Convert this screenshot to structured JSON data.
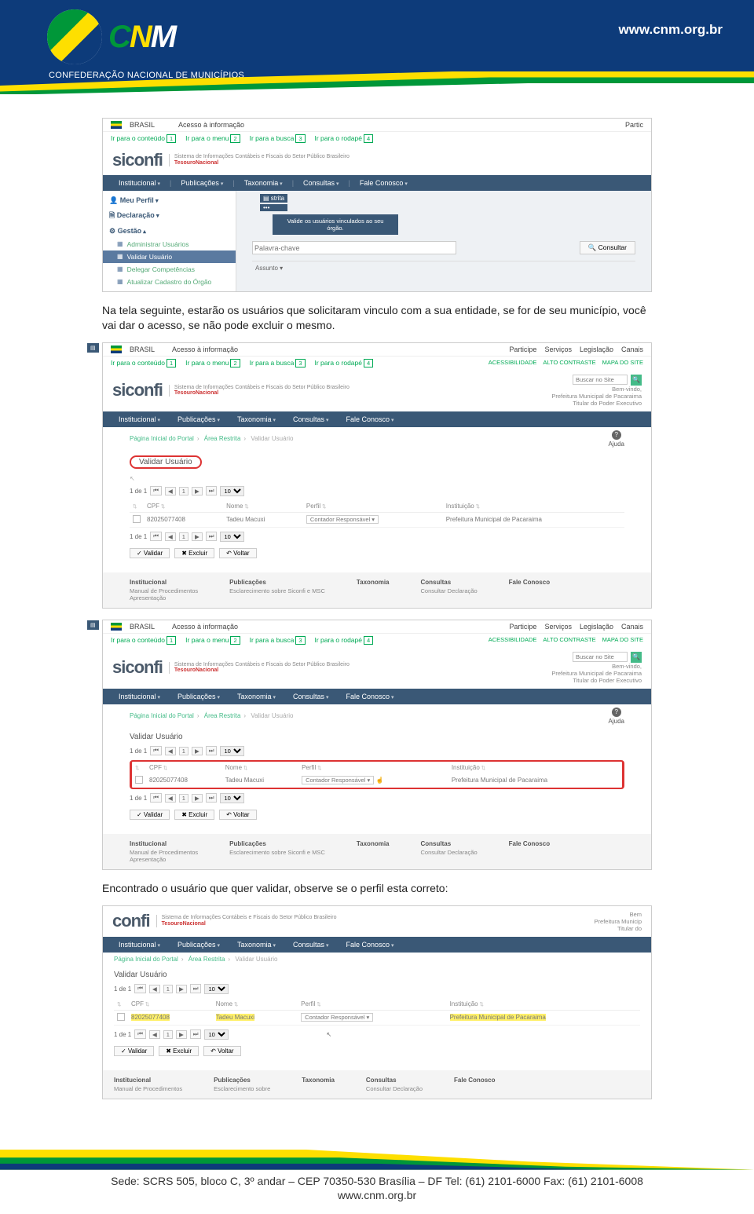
{
  "header": {
    "url": "www.cnm.org.br",
    "logo_letters": [
      "C",
      "N",
      "M"
    ],
    "org_name": "CONFEDERAÇÃO NACIONAL DE MUNICÍPIOS"
  },
  "shot1": {
    "gov_brasil": "BRASIL",
    "gov_acesso": "Acesso à informação",
    "gov_participe": "Partic",
    "skip": [
      {
        "t": "Ir para o conteúdo",
        "n": "1"
      },
      {
        "t": "Ir para o menu",
        "n": "2"
      },
      {
        "t": "Ir para a busca",
        "n": "3"
      },
      {
        "t": "Ir para o rodapé",
        "n": "4"
      }
    ],
    "brand": "siconfi",
    "brand_tag": "Sistema de Informações Contábeis e Fiscais do Setor Público Brasileiro",
    "brand_tn": "TesouroNacional",
    "nav": [
      "Institucional",
      "Publicações",
      "Taxonomia",
      "Consultas",
      "Fale Conosco"
    ],
    "side": {
      "meu_perfil": "Meu Perfil",
      "declaracao": "Declaração",
      "gestao": "Gestão",
      "items": [
        "Administrar Usuários",
        "Validar Usuário",
        "Delegar Competências",
        "Atualizar Cadastro do Órgão"
      ]
    },
    "badge_text": "strita",
    "tooltip": "Valide os usuários vinculados ao seu órgão.",
    "palavra": "Palavra-chave",
    "consultar": "Consultar",
    "assunto": "Assunto"
  },
  "para1": "Na tela seguinte, estarão os usuários que solicitaram vinculo com a sua entidade, se for de seu município, você vai dar o acesso, se não pode excluir o mesmo.",
  "shot_vu": {
    "gov_brasil": "BRASIL",
    "gov_acesso": "Acesso à informação",
    "top_right": [
      "Participe",
      "Serviços",
      "Legislação",
      "Canais"
    ],
    "util": [
      "ACESSIBILIDADE",
      "ALTO CONTRASTE",
      "MAPA DO SITE"
    ],
    "brand": "siconfi",
    "brand_tag": "Sistema de Informações Contábeis e Fiscais do Setor Público Brasileiro",
    "brand_tn": "TesouroNacional",
    "search_ph": "Buscar no Site",
    "welcome": [
      "Bem-vindo,",
      "Prefeitura Municipal de Pacaraima",
      "Titular do Poder Executivo"
    ],
    "nav": [
      "Institucional",
      "Publicações",
      "Taxonomia",
      "Consultas",
      "Fale Conosco"
    ],
    "crumbs": [
      "Página Inicial do Portal",
      "Área Restrita",
      "Validar Usuário"
    ],
    "ajuda": "Ajuda",
    "title": "Validar Usuário",
    "pager_count": "1 de 1",
    "pager_nav": [
      "⏮",
      "◀",
      "1",
      "▶",
      "⏭"
    ],
    "page_size": "10",
    "cols": [
      "CPF",
      "Nome",
      "Perfil",
      "Instituição"
    ],
    "row": {
      "cpf": "82025077408",
      "nome": "Tadeu Macuxi",
      "perfil": "Contador Responsável",
      "inst": "Prefeitura Municipal de Pacaraima"
    },
    "actions": [
      "✓ Validar",
      "✖ Excluir",
      "↶ Voltar"
    ],
    "foot_cols": [
      {
        "h": "Institucional",
        "items": [
          "Manual de Procedimentos",
          "Apresentação"
        ]
      },
      {
        "h": "Publicações",
        "items": [
          "Esclarecimento sobre Siconfi e MSC"
        ]
      },
      {
        "h": "Taxonomia",
        "items": []
      },
      {
        "h": "Consultas",
        "items": [
          "Consultar Declaração"
        ]
      },
      {
        "h": "Fale Conosco",
        "items": []
      }
    ]
  },
  "para2": "Encontrado o usuário que quer validar, observe se o perfil esta correto:",
  "shot3": {
    "brand_partial": "confi",
    "brand_tag": "Sistema de Informações Contábeis e Fiscais do Setor Público Brasileiro",
    "brand_tn": "TesouroNacional",
    "welcome": [
      "Bem",
      "Prefeitura Municip",
      "Titular do"
    ],
    "nav": [
      "Institucional",
      "Publicações",
      "Taxonomia",
      "Consultas",
      "Fale Conosco"
    ],
    "crumbs": [
      "Página Inicial do Portal",
      "Área Restrita",
      "Validar Usuário"
    ],
    "title": "Validar Usuário",
    "pager_count": "1 de 1",
    "pager_nav": [
      "⏮",
      "◀",
      "1",
      "▶",
      "⏭"
    ],
    "page_size": "10",
    "cols": [
      "CPF",
      "Nome",
      "Perfil",
      "Instituição"
    ],
    "row": {
      "cpf": "82025077408",
      "nome": "Tadeu Macuxi",
      "perfil": "Contador Responsável",
      "inst": "Prefeitura Municipal de Pacaraima"
    },
    "actions": [
      "✓ Validar",
      "✖ Excluir",
      "↶ Voltar"
    ],
    "foot_cols": [
      {
        "h": "Institucional",
        "items": [
          "Manual de Procedimentos"
        ]
      },
      {
        "h": "Publicações",
        "items": [
          "Esclarecimento sobre"
        ]
      },
      {
        "h": "Taxonomia",
        "items": []
      },
      {
        "h": "Consultas",
        "items": [
          "Consultar Declaração"
        ]
      },
      {
        "h": "Fale Conosco",
        "items": []
      }
    ]
  },
  "footer": {
    "line1": "Sede: SCRS 505, bloco C, 3º andar – CEP 70350-530  Brasília – DF  Tel: (61) 2101-6000 Fax: (61) 2101-6008",
    "line2": "www.cnm.org.br"
  }
}
